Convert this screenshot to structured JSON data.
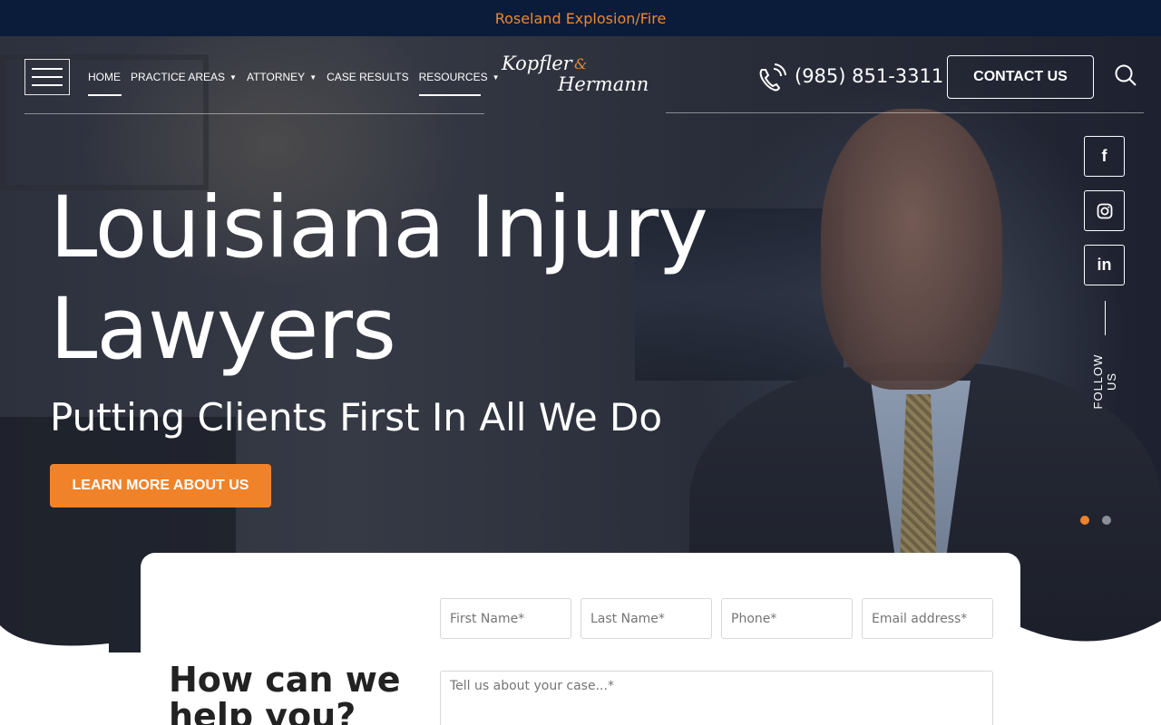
{
  "alert": {
    "text": "Roseland Explosion/Fire"
  },
  "nav": {
    "items": [
      {
        "label": "HOME"
      },
      {
        "label": "PRACTICE AREAS"
      },
      {
        "label": "ATTORNEY"
      },
      {
        "label": "CASE RESULTS"
      },
      {
        "label": "RESOURCES"
      }
    ]
  },
  "logo": {
    "line1": "Kopfler",
    "amp": "&",
    "line2": "Hermann"
  },
  "header": {
    "phone": "(985) 851-3311",
    "contact_label": "CONTACT US"
  },
  "social": {
    "follow_label": "FOLLOW US",
    "facebook": "f",
    "instagram_icon": "instagram-icon",
    "linkedin": "in"
  },
  "hero": {
    "title_line1": "Louisiana Injury",
    "title_line2": "Lawyers",
    "subtitle": "Putting Clients First In All We Do",
    "cta_label": "LEARN MORE ABOUT US",
    "slide_count": 2,
    "active_slide": 1
  },
  "form": {
    "heading_line1": "How can we",
    "heading_line2": "help you?",
    "first_name_placeholder": "First Name*",
    "last_name_placeholder": "Last Name*",
    "phone_placeholder": "Phone*",
    "email_placeholder": "Email address*",
    "case_placeholder": "Tell us about your case...*"
  },
  "colors": {
    "accent": "#f0832a",
    "navy": "#0b1b3a",
    "white": "#ffffff"
  }
}
